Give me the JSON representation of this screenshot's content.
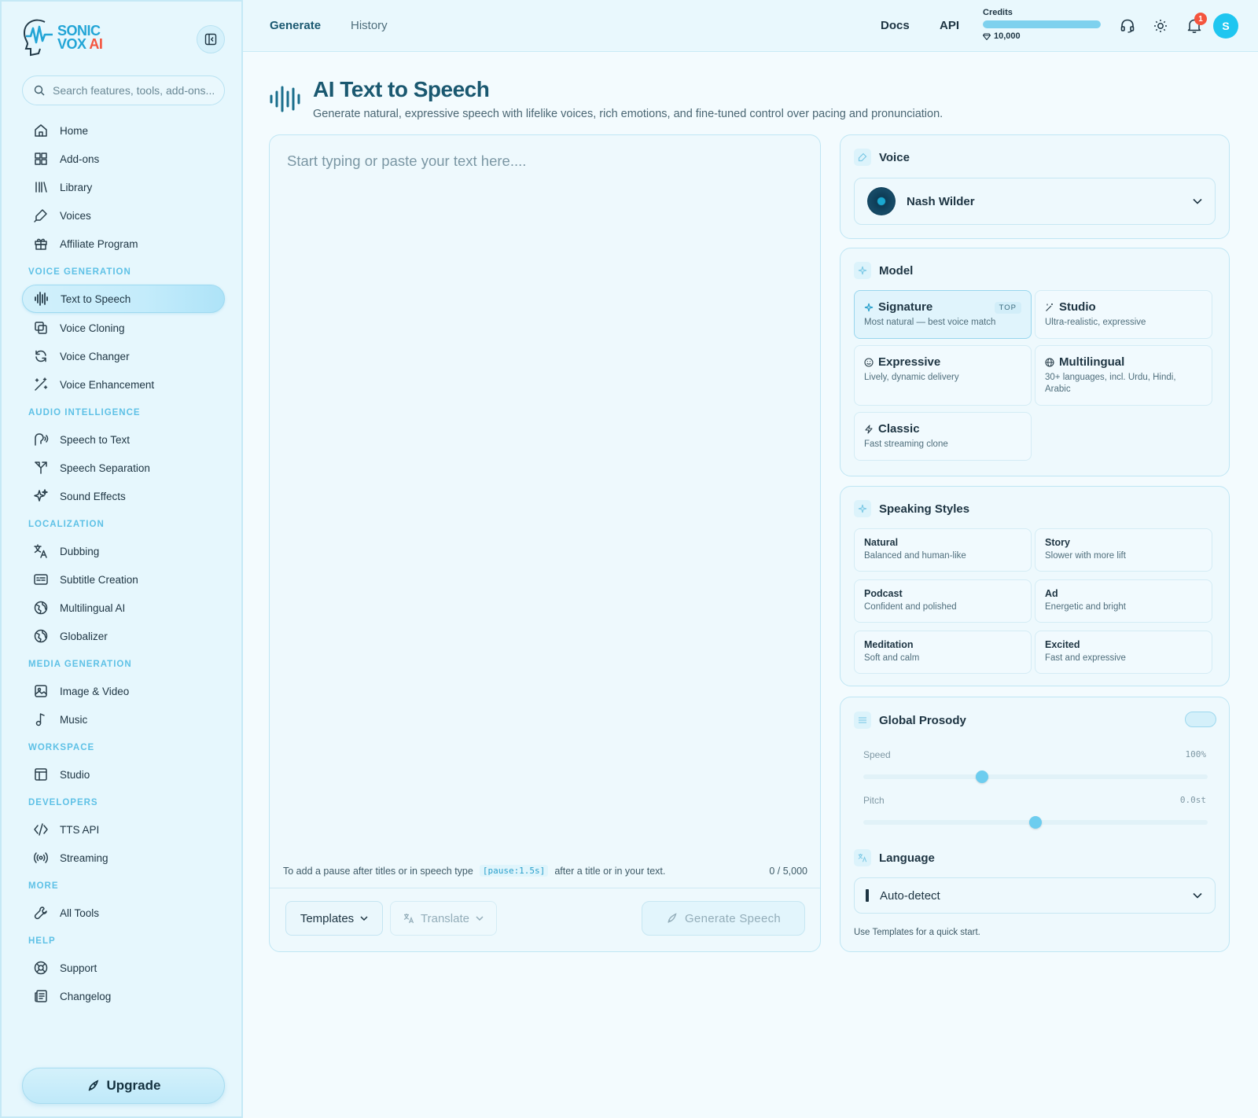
{
  "brand": {
    "line1": "SONIC",
    "line2": "VOX",
    "ai": "AI"
  },
  "search": {
    "placeholder": "Search features, tools, add-ons..."
  },
  "sidebar": {
    "main": [
      {
        "label": "Home",
        "icon": "home-icon"
      },
      {
        "label": "Add-ons",
        "icon": "addons-icon"
      },
      {
        "label": "Library",
        "icon": "library-icon"
      },
      {
        "label": "Voices",
        "icon": "microphone-icon"
      },
      {
        "label": "Affiliate Program",
        "icon": "gift-icon"
      }
    ],
    "sections": [
      {
        "title": "VOICE GENERATION",
        "items": [
          {
            "label": "Text to Speech",
            "icon": "waveform-icon",
            "active": true
          },
          {
            "label": "Voice Cloning",
            "icon": "copy-icon"
          },
          {
            "label": "Voice Changer",
            "icon": "refresh-icon"
          },
          {
            "label": "Voice Enhancement",
            "icon": "magic-wand-icon"
          }
        ]
      },
      {
        "title": "AUDIO INTELLIGENCE",
        "items": [
          {
            "label": "Speech to Text",
            "icon": "speech-icon"
          },
          {
            "label": "Speech Separation",
            "icon": "split-icon"
          },
          {
            "label": "Sound Effects",
            "icon": "sparkles-icon"
          }
        ]
      },
      {
        "title": "LOCALIZATION",
        "items": [
          {
            "label": "Dubbing",
            "icon": "translate-icon"
          },
          {
            "label": "Subtitle Creation",
            "icon": "subtitles-icon"
          },
          {
            "label": "Multilingual AI",
            "icon": "globe-icon"
          },
          {
            "label": "Globalizer",
            "icon": "globe-icon"
          }
        ]
      },
      {
        "title": "MEDIA GENERATION",
        "items": [
          {
            "label": "Image & Video",
            "icon": "image-icon"
          },
          {
            "label": "Music",
            "icon": "music-note-icon"
          }
        ]
      },
      {
        "title": "WORKSPACE",
        "items": [
          {
            "label": "Studio",
            "icon": "layout-icon"
          }
        ]
      },
      {
        "title": "DEVELOPERS",
        "items": [
          {
            "label": "TTS API",
            "icon": "code-icon"
          },
          {
            "label": "Streaming",
            "icon": "broadcast-icon"
          }
        ]
      },
      {
        "title": "MORE",
        "items": [
          {
            "label": "All Tools",
            "icon": "wrench-icon"
          }
        ]
      },
      {
        "title": "HELP",
        "items": [
          {
            "label": "Support",
            "icon": "lifebuoy-icon"
          },
          {
            "label": "Changelog",
            "icon": "newspaper-icon"
          }
        ]
      }
    ],
    "upgrade_label": "Upgrade"
  },
  "topbar": {
    "tabs": [
      {
        "label": "Generate",
        "active": true
      },
      {
        "label": "History",
        "active": false
      }
    ],
    "docs": "Docs",
    "api": "API",
    "credits_label": "Credits",
    "credits_value": "10,000",
    "credits_fraction": 1.0,
    "notification_count": "1",
    "avatar_initial": "S"
  },
  "page": {
    "title": "AI Text to Speech",
    "subtitle": "Generate natural, expressive speech with lifelike voices, rich emotions, and fine-tuned control over pacing and pronunciation."
  },
  "editor": {
    "placeholder": "Start typing or paste your text here....",
    "hint_before": "To add a pause after titles or in speech type",
    "hint_code": "[pause:1.5s]",
    "hint_after": "after a title or in your text.",
    "char_count": "0 / 5,000",
    "templates_label": "Templates",
    "translate_label": "Translate",
    "generate_label": "Generate Speech"
  },
  "voice_panel": {
    "title": "Voice",
    "selected_voice": "Nash Wilder"
  },
  "model_panel": {
    "title": "Model",
    "models": [
      {
        "name": "Signature",
        "desc": "Most natural — best voice match",
        "badge": "TOP",
        "selected": true,
        "icon": "sparkle-icon"
      },
      {
        "name": "Studio",
        "desc": "Ultra-realistic, expressive",
        "icon": "wand-icon"
      },
      {
        "name": "Expressive",
        "desc": "Lively, dynamic delivery",
        "icon": "smile-icon"
      },
      {
        "name": "Multilingual",
        "desc": "30+ languages, incl. Urdu, Hindi, Arabic",
        "icon": "globe-icon"
      },
      {
        "name": "Classic",
        "desc": "Fast streaming clone",
        "icon": "bolt-icon"
      }
    ]
  },
  "styles_panel": {
    "title": "Speaking Styles",
    "styles": [
      {
        "name": "Natural",
        "desc": "Balanced and human-like"
      },
      {
        "name": "Story",
        "desc": "Slower with more lift"
      },
      {
        "name": "Podcast",
        "desc": "Confident and polished"
      },
      {
        "name": "Ad",
        "desc": "Energetic and bright"
      },
      {
        "name": "Meditation",
        "desc": "Soft and calm"
      },
      {
        "name": "Excited",
        "desc": "Fast and expressive"
      }
    ]
  },
  "prosody_panel": {
    "title": "Global Prosody",
    "speed_label": "Speed",
    "speed_value": "100%",
    "speed_fraction": 0.34,
    "pitch_label": "Pitch",
    "pitch_value": "0.0st",
    "pitch_fraction": 0.5,
    "language_title": "Language",
    "language_value": "Auto-detect",
    "footer": "Use Templates for a quick start."
  },
  "colors": {
    "accent": "#22a5d6",
    "brand_ai": "#f4553e",
    "avatar": "#1fc6f0"
  }
}
